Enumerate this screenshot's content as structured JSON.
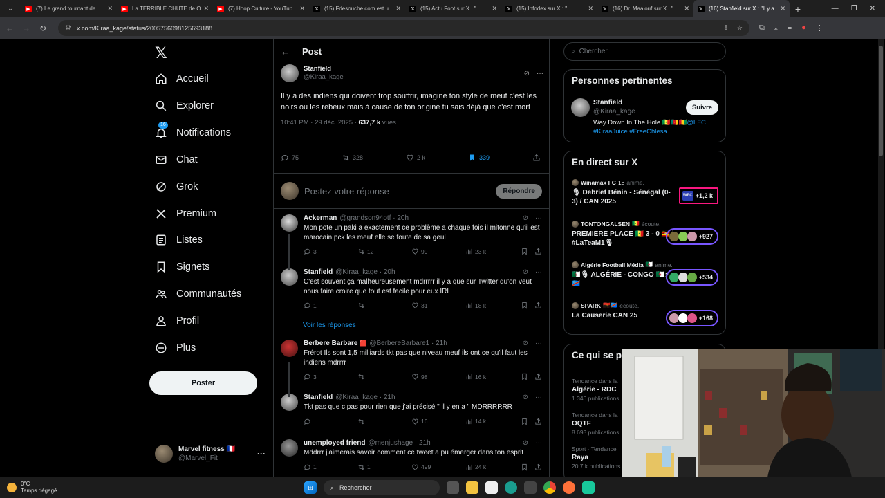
{
  "browser": {
    "tabs": [
      {
        "title": "(7) Le grand tournant de",
        "favicon": "youtube-icon",
        "color": "#ff0000"
      },
      {
        "title": "La TERRIBLE CHUTE de O",
        "favicon": "youtube-icon",
        "color": "#ff0000"
      },
      {
        "title": "(7) Hoop Culture - YouTub",
        "favicon": "youtube-icon",
        "color": "#ff0000"
      },
      {
        "title": "(15) Fdesouche.com est u",
        "favicon": "x-icon",
        "color": "#000000"
      },
      {
        "title": "(15) Actu Foot sur X : \"",
        "favicon": "x-icon",
        "color": "#000000"
      },
      {
        "title": "(15) Infodex sur X : \"",
        "favicon": "x-icon",
        "color": "#000000"
      },
      {
        "title": "(16) Dr. Maalouf sur X : \"",
        "favicon": "x-icon",
        "color": "#000000"
      },
      {
        "title": "(16) Stanfield sur X : \"Il y a",
        "favicon": "x-icon",
        "color": "#000000",
        "active": true
      }
    ],
    "url": "x.com/Kiraa_kage/status/2005756098125693188"
  },
  "nav": {
    "items": [
      {
        "label": "Accueil",
        "icon": "home-icon"
      },
      {
        "label": "Explorer",
        "icon": "search-icon"
      },
      {
        "label": "Notifications",
        "icon": "bell-icon",
        "badge": "16"
      },
      {
        "label": "Chat",
        "icon": "mail-icon"
      },
      {
        "label": "Grok",
        "icon": "grok-icon"
      },
      {
        "label": "Premium",
        "icon": "x-logo-icon"
      },
      {
        "label": "Listes",
        "icon": "list-icon"
      },
      {
        "label": "Signets",
        "icon": "bookmark-icon"
      },
      {
        "label": "Communautés",
        "icon": "communities-icon"
      },
      {
        "label": "Profil",
        "icon": "person-icon"
      },
      {
        "label": "Plus",
        "icon": "more-circle-icon"
      }
    ],
    "post_button": "Poster",
    "account": {
      "name": "Marvel fitness 🇫🇷",
      "handle": "@Marvel_Fit"
    }
  },
  "main": {
    "header": "Post",
    "post": {
      "name": "Stanfield",
      "handle": "@Kiraa_kage",
      "text": "Il y a des indiens qui doivent trop souffrir, imagine ton style de meuf c'est les noirs ou les rebeux mais à cause de ton origine tu sais déjà que c'est mort",
      "time": "10:41 PM · 29 déc. 2025 · ",
      "views": "637,7 k",
      "views_label": " vues",
      "replies": "75",
      "reposts": "328",
      "likes": "2 k",
      "bookmarks": "339"
    },
    "composer": {
      "placeholder": "Postez votre réponse",
      "button": "Répondre"
    },
    "replies": [
      {
        "name": "Ackerman",
        "handle": "@grandson94otf · 20h",
        "text": "Mon pote un paki a exactement ce problème a chaque fois il mitonne qu'il est marocain pck les meuf elle se foute de sa geul",
        "r": "3",
        "rt": "12",
        "l": "99",
        "v": "23 k"
      },
      {
        "name": "Stanfield",
        "handle": "@Kiraa_kage · 20h",
        "text": "C'est souvent ça malheureusement mdrrrrr il y a que sur Twitter qu'on veut nous faire croire que tout est facile pour eux IRL",
        "r": "1",
        "rt": "",
        "l": "31",
        "v": "18 k"
      },
      {
        "name": "Berbere Barbare",
        "flag": "🟥",
        "handle": "@BerbereBarbare1 · 21h",
        "text": "Frérot Ils sont 1,5 milliards tkt pas que niveau meuf ils ont ce qu'il faut les indiens mdrrrr",
        "r": "3",
        "rt": "",
        "l": "98",
        "v": "16 k"
      },
      {
        "name": "Stanfield",
        "handle": "@Kiraa_kage · 21h",
        "text": "Tkt pas que c pas pour rien que j'ai précisé \" il y en a \" MDRRRRRR",
        "r": "",
        "rt": "",
        "l": "16",
        "v": "14 k"
      },
      {
        "name": "unemployed friend",
        "handle": "@menjushage · 21h",
        "text": "Mddrrr j'aimerais savoir comment ce tweet a pu émerger dans ton esprit",
        "r": "1",
        "rt": "1",
        "l": "499",
        "v": "24 k"
      }
    ],
    "see_replies": "Voir les réponses"
  },
  "right": {
    "search_placeholder": "Chercher",
    "relevant": {
      "title": "Personnes pertinentes",
      "name": "Stanfield",
      "handle": "@Kiraa_kage",
      "bio1": "Way Down In The Hole 🇸🇳🇨🇲🇬🇳",
      "bio_link": "@LFC",
      "bio2": "#KiraaJuice #FreeChlesa",
      "follow": "Suivre"
    },
    "live": {
      "title": "En direct sur X",
      "items": [
        {
          "host": "Winamax FC",
          "tag": "18",
          "status": "anime.",
          "title": "🎙 Debrief Bénin - Sénégal (0-3) / CAN 2025",
          "count": "+1,2 k"
        },
        {
          "host": "TONTONGALSEN",
          "tag": "🇸🇳",
          "status": "écoute.",
          "title": "PREMIERE PLACE 🇸🇳 3 - 0 🇺🇬 | #LaTeaM1🎙",
          "count": "+927"
        },
        {
          "host": "Algérie Football Média",
          "tag": "🇩🇿",
          "status": "anime.",
          "title": "🇩🇿🎙 ALGÉRIE - CONGO 🇩🇿⚡🇨🇩",
          "count": "+534"
        },
        {
          "host": "SPARK",
          "tag": "🇦🇴🇨🇩",
          "status": "écoute.",
          "title": "La Causerie CAN 25",
          "count": "+168"
        }
      ]
    },
    "trends": {
      "title": "Ce qui se passe",
      "items": [
        {
          "context": "Tendance dans la",
          "name": "Algérie - RDC",
          "count": "1 346 publications"
        },
        {
          "context": "Tendance dans la",
          "name": "OQTF",
          "count": "8 693 publications"
        },
        {
          "context": "Sport · Tendance",
          "name": "Raya",
          "count": "20,7 k publications"
        }
      ]
    }
  },
  "taskbar": {
    "temp": "0°C",
    "weather": "Temps dégagé",
    "search": "Rechercher"
  }
}
